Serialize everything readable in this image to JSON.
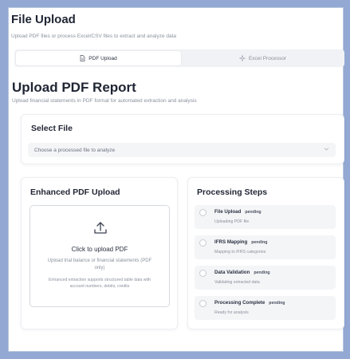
{
  "header": {
    "title": "File Upload",
    "subtitle": "Upload PDF files or process Excel/CSV files to extract and analyze data"
  },
  "tabs": [
    {
      "label": "PDF Upload",
      "icon": "file-icon",
      "active": true
    },
    {
      "label": "Excel Processor",
      "icon": "sparkle-icon",
      "active": false
    }
  ],
  "section": {
    "title": "Upload PDF Report",
    "subtitle": "Upload financial statements in PDF format for automated extraction and analysis"
  },
  "select_file": {
    "title": "Select File",
    "placeholder": "Choose a processed file to analyze"
  },
  "upload": {
    "title": "Enhanced PDF Upload",
    "main": "Click to upload PDF",
    "sub": "Upload trial balance or financial statements (PDF only)",
    "note": "Enhanced extraction supports structured table data with account numbers, debits, credits"
  },
  "steps": {
    "title": "Processing Steps",
    "items": [
      {
        "label": "File Upload",
        "status": "pending",
        "desc": "Uploading PDF file"
      },
      {
        "label": "IFRS Mapping",
        "status": "pending",
        "desc": "Mapping to IFRS categories"
      },
      {
        "label": "Data Validation",
        "status": "pending",
        "desc": "Validating extracted data"
      },
      {
        "label": "Processing Complete",
        "status": "pending",
        "desc": "Ready for analysis"
      }
    ]
  },
  "colors": {
    "background": "#93a9d3",
    "text": "#1f2533",
    "muted": "#8a909c"
  }
}
